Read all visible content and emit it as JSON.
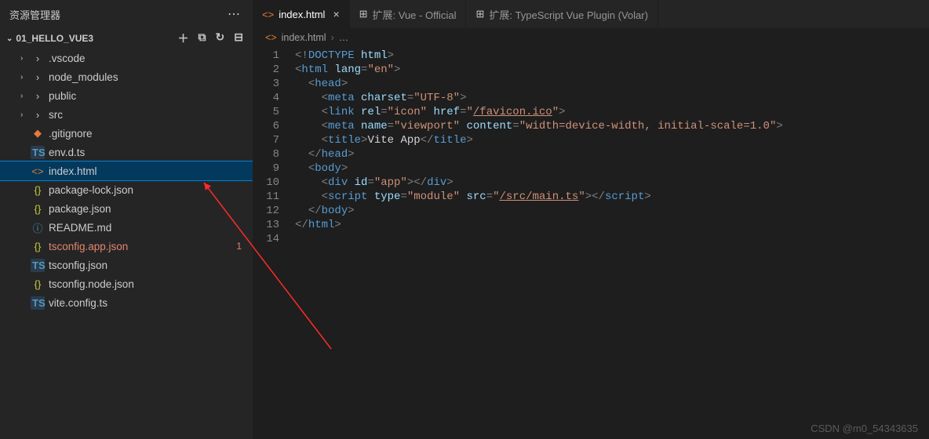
{
  "sidebar": {
    "title": "资源管理器",
    "project": "01_HELLO_VUE3",
    "actions": {
      "newFile": "＋",
      "newFolder": "⧉",
      "refresh": "↻",
      "collapse": "⊟"
    },
    "items": [
      {
        "label": ".vscode",
        "icon": "›",
        "iconClass": "icon-folder",
        "type": "folder",
        "depth": 1
      },
      {
        "label": "node_modules",
        "icon": "›",
        "iconClass": "icon-folder",
        "type": "folder",
        "depth": 1
      },
      {
        "label": "public",
        "icon": "›",
        "iconClass": "icon-folder",
        "type": "folder",
        "depth": 1
      },
      {
        "label": "src",
        "icon": "›",
        "iconClass": "icon-folder",
        "type": "folder",
        "depth": 1
      },
      {
        "label": ".gitignore",
        "icon": "◆",
        "iconClass": "icon-git",
        "type": "file",
        "depth": 1
      },
      {
        "label": "env.d.ts",
        "icon": "TS",
        "iconClass": "icon-ts",
        "type": "file",
        "depth": 1
      },
      {
        "label": "index.html",
        "icon": "<>",
        "iconClass": "icon-html",
        "type": "file",
        "depth": 1,
        "selected": true
      },
      {
        "label": "package-lock.json",
        "icon": "{}",
        "iconClass": "icon-json",
        "type": "file",
        "depth": 1
      },
      {
        "label": "package.json",
        "icon": "{}",
        "iconClass": "icon-json",
        "type": "file",
        "depth": 1
      },
      {
        "label": "README.md",
        "icon": "ⓘ",
        "iconClass": "icon-info",
        "type": "file",
        "depth": 1
      },
      {
        "label": "tsconfig.app.json",
        "icon": "{}",
        "iconClass": "icon-json",
        "type": "file",
        "depth": 1,
        "modified": true,
        "badge": "1"
      },
      {
        "label": "tsconfig.json",
        "icon": "TS",
        "iconClass": "icon-ts",
        "type": "file",
        "depth": 1
      },
      {
        "label": "tsconfig.node.json",
        "icon": "{}",
        "iconClass": "icon-json",
        "type": "file",
        "depth": 1
      },
      {
        "label": "vite.config.ts",
        "icon": "TS",
        "iconClass": "icon-ts",
        "type": "file",
        "depth": 1
      }
    ]
  },
  "tabs": [
    {
      "label": "index.html",
      "icon": "<>",
      "iconClass": "icon-html",
      "active": true,
      "close": true
    },
    {
      "label": "扩展: Vue - Official",
      "icon": "⊞",
      "iconClass": "icon-ext",
      "active": false
    },
    {
      "label": "扩展: TypeScript Vue Plugin (Volar)",
      "icon": "⊞",
      "iconClass": "icon-ext",
      "active": false
    }
  ],
  "breadcrumb": {
    "icon": "<>",
    "file": "index.html",
    "rest": "…"
  },
  "code_lines": [
    [
      {
        "c": "tk-br",
        "t": "<!"
      },
      {
        "c": "tk-doctype",
        "t": "DOCTYPE "
      },
      {
        "c": "tk-attr",
        "t": "html"
      },
      {
        "c": "tk-br",
        "t": ">"
      }
    ],
    [
      {
        "c": "tk-br",
        "t": "<"
      },
      {
        "c": "tk-tag",
        "t": "html "
      },
      {
        "c": "tk-attr",
        "t": "lang"
      },
      {
        "c": "tk-br",
        "t": "="
      },
      {
        "c": "tk-val",
        "t": "\"en\""
      },
      {
        "c": "tk-br",
        "t": ">"
      }
    ],
    [
      {
        "c": "",
        "t": "  "
      },
      {
        "c": "tk-br",
        "t": "<"
      },
      {
        "c": "tk-tag",
        "t": "head"
      },
      {
        "c": "tk-br",
        "t": ">"
      }
    ],
    [
      {
        "c": "",
        "t": "    "
      },
      {
        "c": "tk-br",
        "t": "<"
      },
      {
        "c": "tk-tag",
        "t": "meta "
      },
      {
        "c": "tk-attr",
        "t": "charset"
      },
      {
        "c": "tk-br",
        "t": "="
      },
      {
        "c": "tk-val",
        "t": "\"UTF-8\""
      },
      {
        "c": "tk-br",
        "t": ">"
      }
    ],
    [
      {
        "c": "",
        "t": "    "
      },
      {
        "c": "tk-br",
        "t": "<"
      },
      {
        "c": "tk-tag",
        "t": "link "
      },
      {
        "c": "tk-attr",
        "t": "rel"
      },
      {
        "c": "tk-br",
        "t": "="
      },
      {
        "c": "tk-val",
        "t": "\"icon\" "
      },
      {
        "c": "tk-attr",
        "t": "href"
      },
      {
        "c": "tk-br",
        "t": "="
      },
      {
        "c": "tk-val",
        "t": "\""
      },
      {
        "c": "tk-valu",
        "t": "/favicon.ico"
      },
      {
        "c": "tk-val",
        "t": "\""
      },
      {
        "c": "tk-br",
        "t": ">"
      }
    ],
    [
      {
        "c": "",
        "t": "    "
      },
      {
        "c": "tk-br",
        "t": "<"
      },
      {
        "c": "tk-tag",
        "t": "meta "
      },
      {
        "c": "tk-attr",
        "t": "name"
      },
      {
        "c": "tk-br",
        "t": "="
      },
      {
        "c": "tk-val",
        "t": "\"viewport\" "
      },
      {
        "c": "tk-attr",
        "t": "content"
      },
      {
        "c": "tk-br",
        "t": "="
      },
      {
        "c": "tk-val",
        "t": "\"width=device-width, initial-scale=1.0\""
      },
      {
        "c": "tk-br",
        "t": ">"
      }
    ],
    [
      {
        "c": "",
        "t": "    "
      },
      {
        "c": "tk-br",
        "t": "<"
      },
      {
        "c": "tk-tag",
        "t": "title"
      },
      {
        "c": "tk-br",
        "t": ">"
      },
      {
        "c": "tk-txt",
        "t": "Vite App"
      },
      {
        "c": "tk-br",
        "t": "</"
      },
      {
        "c": "tk-tag",
        "t": "title"
      },
      {
        "c": "tk-br",
        "t": ">"
      }
    ],
    [
      {
        "c": "",
        "t": "  "
      },
      {
        "c": "tk-br",
        "t": "</"
      },
      {
        "c": "tk-tag",
        "t": "head"
      },
      {
        "c": "tk-br",
        "t": ">"
      }
    ],
    [
      {
        "c": "",
        "t": "  "
      },
      {
        "c": "tk-br",
        "t": "<"
      },
      {
        "c": "tk-tag",
        "t": "body"
      },
      {
        "c": "tk-br",
        "t": ">"
      }
    ],
    [
      {
        "c": "",
        "t": "    "
      },
      {
        "c": "tk-br",
        "t": "<"
      },
      {
        "c": "tk-tag",
        "t": "div "
      },
      {
        "c": "tk-attr",
        "t": "id"
      },
      {
        "c": "tk-br",
        "t": "="
      },
      {
        "c": "tk-val",
        "t": "\"app\""
      },
      {
        "c": "tk-br",
        "t": "></"
      },
      {
        "c": "tk-tag",
        "t": "div"
      },
      {
        "c": "tk-br",
        "t": ">"
      }
    ],
    [
      {
        "c": "",
        "t": "    "
      },
      {
        "c": "tk-br",
        "t": "<"
      },
      {
        "c": "tk-tag",
        "t": "script "
      },
      {
        "c": "tk-attr",
        "t": "type"
      },
      {
        "c": "tk-br",
        "t": "="
      },
      {
        "c": "tk-val",
        "t": "\"module\" "
      },
      {
        "c": "tk-attr",
        "t": "src"
      },
      {
        "c": "tk-br",
        "t": "="
      },
      {
        "c": "tk-val",
        "t": "\""
      },
      {
        "c": "tk-valu",
        "t": "/src/main.ts"
      },
      {
        "c": "tk-val",
        "t": "\""
      },
      {
        "c": "tk-br",
        "t": "></"
      },
      {
        "c": "tk-tag",
        "t": "script"
      },
      {
        "c": "tk-br",
        "t": ">"
      }
    ],
    [
      {
        "c": "",
        "t": "  "
      },
      {
        "c": "tk-br",
        "t": "</"
      },
      {
        "c": "tk-tag",
        "t": "body"
      },
      {
        "c": "tk-br",
        "t": ">"
      }
    ],
    [
      {
        "c": "tk-br",
        "t": "</"
      },
      {
        "c": "tk-tag",
        "t": "html"
      },
      {
        "c": "tk-br",
        "t": ">"
      }
    ],
    []
  ],
  "watermark": "CSDN @m0_54343635"
}
